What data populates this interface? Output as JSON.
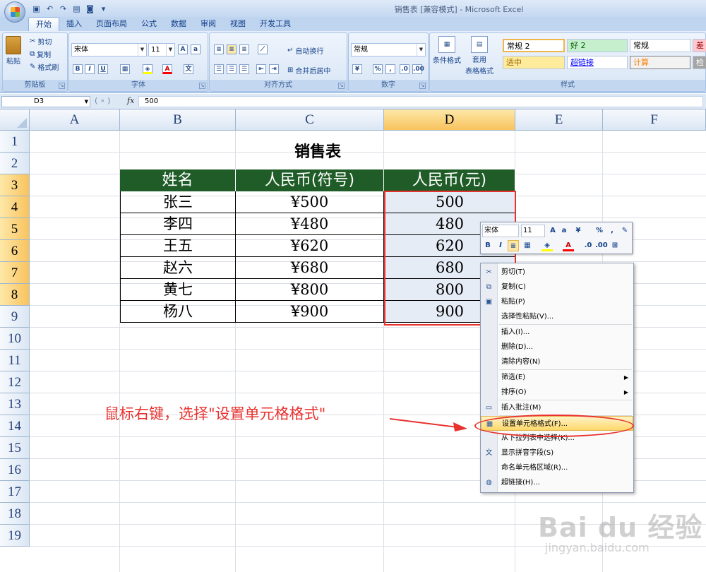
{
  "window_title": "销售表 [兼容模式] - Microsoft Excel",
  "tabs": [
    {
      "label": "开始",
      "active": true
    },
    {
      "label": "插入"
    },
    {
      "label": "页面布局"
    },
    {
      "label": "公式"
    },
    {
      "label": "数据"
    },
    {
      "label": "审阅"
    },
    {
      "label": "视图"
    },
    {
      "label": "开发工具"
    }
  ],
  "ribbon": {
    "clipboard": {
      "paste": "粘贴",
      "cut": "剪切",
      "copy": "复制",
      "format_painter": "格式刷",
      "label": "剪贴板"
    },
    "font": {
      "name": "宋体",
      "size": "11",
      "label": "字体",
      "bold": "B",
      "italic": "I",
      "underline": "U"
    },
    "alignment": {
      "wrap": "自动换行",
      "merge": "合并后居中",
      "label": "对齐方式"
    },
    "number": {
      "format": "常规",
      "percent": "%",
      "label": "数字"
    },
    "styles": {
      "conditional": "条件格式",
      "table_format_1": "套用",
      "table_format_2": "表格格式",
      "label": "样式",
      "cells": [
        {
          "text": "常规 2",
          "bg": "#ffffff",
          "fg": "#000000"
        },
        {
          "text": "好 2",
          "bg": "#c6efce",
          "fg": "#006100"
        },
        {
          "text": "常规",
          "bg": "#ffffff",
          "fg": "#000000"
        },
        {
          "text": "差",
          "bg": "#ffc7ce",
          "fg": "#9c0006"
        },
        {
          "text": "适中",
          "bg": "#ffeb9c",
          "fg": "#9c6500"
        },
        {
          "text": "超链接",
          "bg": "#ffffff",
          "fg": "#0000ff"
        },
        {
          "text": "计算",
          "bg": "#f2f2f2",
          "fg": "#fa7d00"
        },
        {
          "text": "检",
          "bg": "#a5a5a5",
          "fg": "#ffffff"
        }
      ]
    }
  },
  "formula_bar": {
    "name_box": "D3",
    "fx": "fx",
    "value": "500"
  },
  "grid": {
    "columns": [
      "A",
      "B",
      "C",
      "D",
      "E",
      "F"
    ],
    "selected_column": "D",
    "rows": [
      "1",
      "2",
      "3",
      "4",
      "5",
      "6",
      "7",
      "8",
      "9",
      "10",
      "11",
      "12",
      "13",
      "14",
      "15",
      "16",
      "17",
      "18",
      "19"
    ],
    "selected_rows": [
      "3",
      "4",
      "5",
      "6",
      "7",
      "8"
    ]
  },
  "sheet": {
    "title": "销售表",
    "headers": [
      "姓名",
      "人民币(符号)",
      "人民币(元)"
    ],
    "rows": [
      [
        "张三",
        "¥500",
        "500"
      ],
      [
        "李四",
        "¥480",
        "480"
      ],
      [
        "王五",
        "¥620",
        "620"
      ],
      [
        "赵六",
        "¥680",
        "680"
      ],
      [
        "黄七",
        "¥800",
        "800"
      ],
      [
        "杨八",
        "¥900",
        "900"
      ]
    ]
  },
  "mini_toolbar": {
    "font": "宋体",
    "size": "11",
    "percent": "%",
    "comma": ","
  },
  "context_menu": [
    {
      "label": "剪切(T)",
      "icon": "scissors-icon"
    },
    {
      "label": "复制(C)",
      "icon": "copy-icon"
    },
    {
      "label": "粘贴(P)",
      "icon": "paste-icon"
    },
    {
      "label": "选择性粘贴(V)...",
      "sep_after": true
    },
    {
      "label": "插入(I)..."
    },
    {
      "label": "删除(D)..."
    },
    {
      "label": "清除内容(N)",
      "sep_after": true
    },
    {
      "label": "筛选(E)",
      "submenu": true
    },
    {
      "label": "排序(O)",
      "submenu": true,
      "sep_after": true
    },
    {
      "label": "插入批注(M)",
      "icon": "comment-icon",
      "sep_after": true
    },
    {
      "label": "设置单元格格式(F)...",
      "icon": "format-cells-icon",
      "highlight": true
    },
    {
      "label": "从下拉列表中选择(K)..."
    },
    {
      "label": "显示拼音字段(S)",
      "icon": "phonetic-icon"
    },
    {
      "label": "命名单元格区域(R)..."
    },
    {
      "label": "超链接(H)...",
      "icon": "hyperlink-icon"
    }
  ],
  "annotation": "鼠标右键，选择\"设置单元格格式\"",
  "watermark": {
    "brand": "Bai du 经验",
    "url": "jingyan.baidu.com"
  },
  "colors": {
    "header_green": "#1f5c27",
    "annotation_red": "#e8322f",
    "selected_header": "#f9c35e"
  }
}
